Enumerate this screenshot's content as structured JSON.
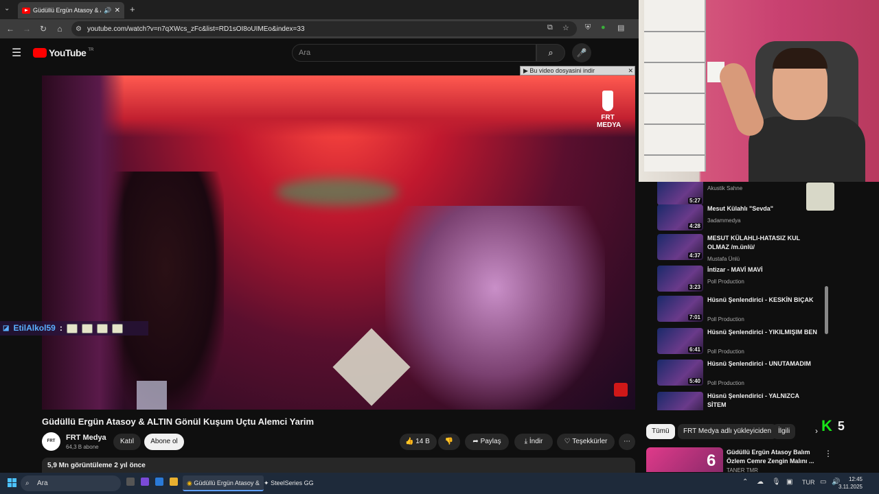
{
  "browser": {
    "tab_title": "Güdüllü Ergün Atasoy & AL",
    "new_tab": "+",
    "url": "youtube.com/watch?v=n7qXWcs_zFc&list=RD1sOI8oUIMEo&index=33"
  },
  "youtube": {
    "logo": "YouTube",
    "region": "TR",
    "search_placeholder": "Ara"
  },
  "video": {
    "download_bar": "Bu video dosyasini indir",
    "watermark": "FRT MEDYA",
    "chat_user": "EtilAlkol59",
    "title": "Güdüllü Ergün Atasoy & ALTIN Gönül Kuşum Uçtu Alemci Yarim",
    "channel": "FRT Medya",
    "subs": "64,3 B abone",
    "join": "Katıl",
    "subscribe": "Abone ol",
    "likes": "14 B",
    "share": "Paylaş",
    "download": "İndir",
    "thanks": "Teşekkürler",
    "views": "5,9 Mn görüntüleme  2 yıl önce"
  },
  "playlist": [
    {
      "title": "",
      "channel": "Akustik Sahne",
      "duration": "5:27"
    },
    {
      "title": "Mesut Külahlı \"Sevda\"",
      "channel": "3adammedya",
      "duration": "4:28"
    },
    {
      "title": "MESUT KÜLAHLI-HATASIZ KUL OLMAZ /m.ünlü/",
      "channel": "Mustafa Ünlü",
      "duration": "4:37"
    },
    {
      "title": "İntizar - MAVİ MAVİ",
      "channel": "Poll Production",
      "duration": "3:23"
    },
    {
      "title": "Hüsnü Şenlendirici - KESKİN BIÇAK",
      "channel": "Poll Production",
      "duration": "7:01"
    },
    {
      "title": "Hüsnü Şenlendirici - YIKILMIŞIM BEN",
      "channel": "Poll Production",
      "duration": "6:41"
    },
    {
      "title": "Hüsnü Şenlendirici - UNUTAMADIM",
      "channel": "Poll Production",
      "duration": "5:40"
    },
    {
      "title": "Hüsnü Şenlendirici - YALNIZCA SİTEM",
      "channel": "",
      "duration": ""
    }
  ],
  "chips": [
    "Tümü",
    "FRT Medya adlı yükleyiciden",
    "İlgili"
  ],
  "reco": {
    "title": "Güdüllü Ergün Atasoy Balım Özlem Cemre Zengin Malını ...",
    "channel": "TANER TMR",
    "badge": "6"
  },
  "overlay_counter": {
    "letter": "K",
    "value": "5"
  },
  "taskbar": {
    "search": "Ara",
    "app1": "Güdüllü Ergün Atasoy &",
    "app2": "SteelSeries GG",
    "lang": "TUR",
    "time": "12:45",
    "date": "3.11.2025"
  },
  "colors": {
    "youtube_red": "#ff0000",
    "accent_blue": "#60a0ff",
    "counter_green": "#19e619"
  }
}
